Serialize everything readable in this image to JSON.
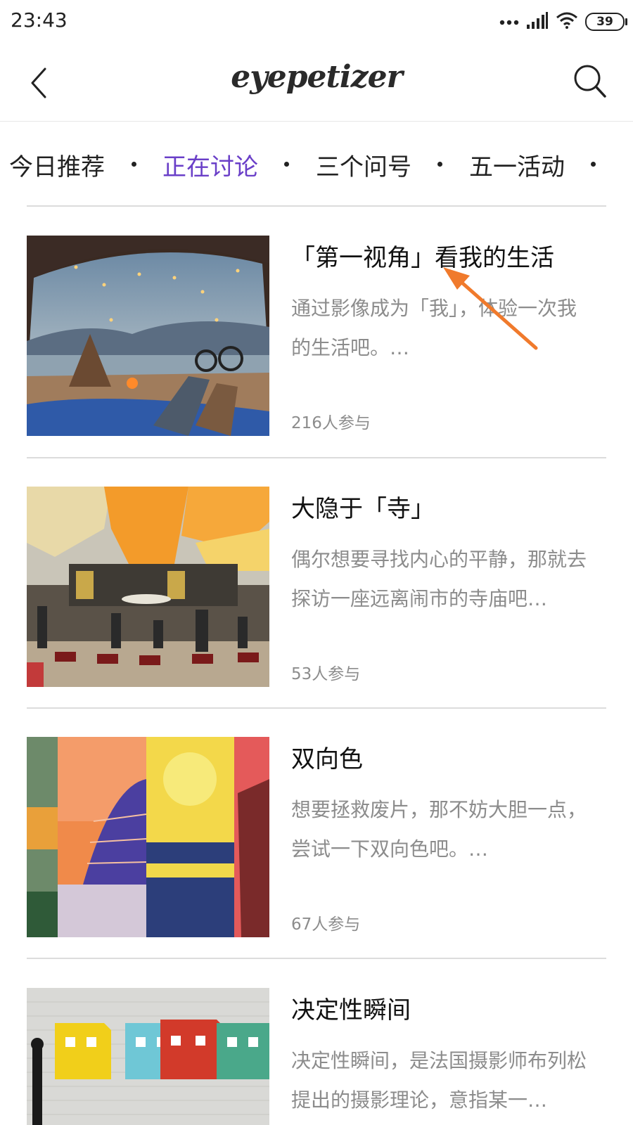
{
  "status_bar": {
    "time": "23:43",
    "battery": "39"
  },
  "header": {
    "brand": "eyepetizer"
  },
  "tabs": [
    {
      "label": "今日推荐",
      "active": false
    },
    {
      "label": "正在讨论",
      "active": true
    },
    {
      "label": "三个问号",
      "active": false
    },
    {
      "label": "五一活动",
      "active": false
    }
  ],
  "cards": [
    {
      "title": "「第一视角」看我的生活",
      "description": "通过影像成为「我」，体验一次我的生活吧。…",
      "participants": "216人参与"
    },
    {
      "title": "大隐于「寺」",
      "description": "偶尔想要寻找内心的平静，那就去探访一座远离闹市的寺庙吧…",
      "participants": "53人参与"
    },
    {
      "title": "双向色",
      "description": "想要拯救废片，那不妨大胆一点，尝试一下双向色吧。…",
      "participants": "67人参与"
    },
    {
      "title": "决定性瞬间",
      "description": "决定性瞬间，是法国摄影师布列松提出的摄影理论，意指某一…",
      "participants": ""
    }
  ],
  "colors": {
    "accent": "#6a3fc8",
    "annotation": "#f07a2c",
    "muted_text": "#8c8c8c"
  },
  "icons": [
    "back-arrow-icon",
    "search-icon",
    "signal-icon",
    "wifi-icon",
    "battery-icon"
  ]
}
